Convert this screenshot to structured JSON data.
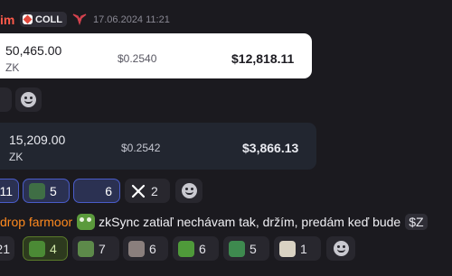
{
  "header": {
    "username": "im",
    "badge": "COLL",
    "timestamp": "17.06.2024 11:21"
  },
  "trade1": {
    "amount": "50,465.00",
    "token": "ZK",
    "price": "$0.2540",
    "total": "$12,818.11"
  },
  "trade2": {
    "amount": "15,209.00",
    "token": "ZK",
    "price": "$0.2542",
    "total": "$3,866.13"
  },
  "reactions2": [
    {
      "count": "11"
    },
    {
      "count": "5"
    },
    {
      "count": "6"
    },
    {
      "count": "2"
    }
  ],
  "chat": {
    "sender": "drop farmoor",
    "message": "zkSync zatiaľ nechávam tak, držím, predám keď bude",
    "cashtag": "$Z"
  },
  "reactions3": [
    {
      "count": "21"
    },
    {
      "count": "4"
    },
    {
      "count": "7"
    },
    {
      "count": "6"
    },
    {
      "count": "6"
    },
    {
      "count": "5"
    },
    {
      "count": "1"
    }
  ],
  "colors": {
    "background": "#1b1a1f",
    "username": "#ff5a4a",
    "sender": "#ff8a1f",
    "selected_border": "#4a5cc9"
  }
}
